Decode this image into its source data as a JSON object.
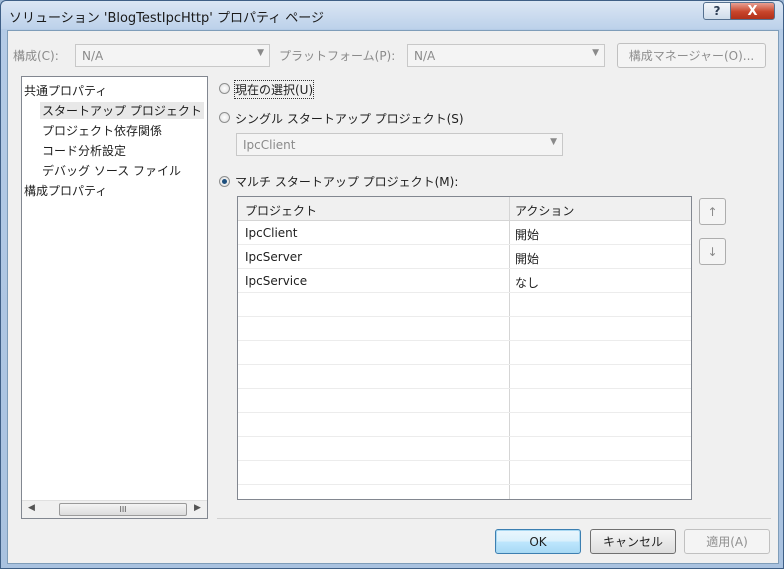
{
  "window": {
    "title": "ソリューション 'BlogTestIpcHttp' プロパティ ページ",
    "help_glyph": "?",
    "close_glyph": "X"
  },
  "toolbar": {
    "config_label": "構成(C):",
    "config_value": "N/A",
    "platform_label": "プラットフォーム(P):",
    "platform_value": "N/A",
    "config_manager_label": "構成マネージャー(O)..."
  },
  "tree": {
    "items": [
      {
        "label": "共通プロパティ"
      },
      {
        "label": "スタートアップ プロジェクト"
      },
      {
        "label": "プロジェクト依存関係"
      },
      {
        "label": "コード分析設定"
      },
      {
        "label": "デバッグ ソース ファイル"
      },
      {
        "label": "構成プロパティ"
      }
    ],
    "scroll_left": "◀",
    "scroll_right": "▶",
    "scroll_grip": "III"
  },
  "options": {
    "current_selection": "現在の選択(U)",
    "single_startup": "シングル スタートアップ プロジェクト(S)",
    "single_value": "IpcClient",
    "multi_startup": "マルチ スタートアップ プロジェクト(M):",
    "selected": "multi"
  },
  "grid": {
    "columns": [
      "プロジェクト",
      "アクション"
    ],
    "rows": [
      {
        "project": "IpcClient",
        "action": "開始"
      },
      {
        "project": "IpcServer",
        "action": "開始"
      },
      {
        "project": "IpcService",
        "action": "なし"
      }
    ],
    "move_up": "↑",
    "move_down": "↓"
  },
  "buttons": {
    "ok": "OK",
    "cancel": "キャンセル",
    "apply": "適用(A)"
  },
  "icons": {
    "dropdown": "▼"
  }
}
